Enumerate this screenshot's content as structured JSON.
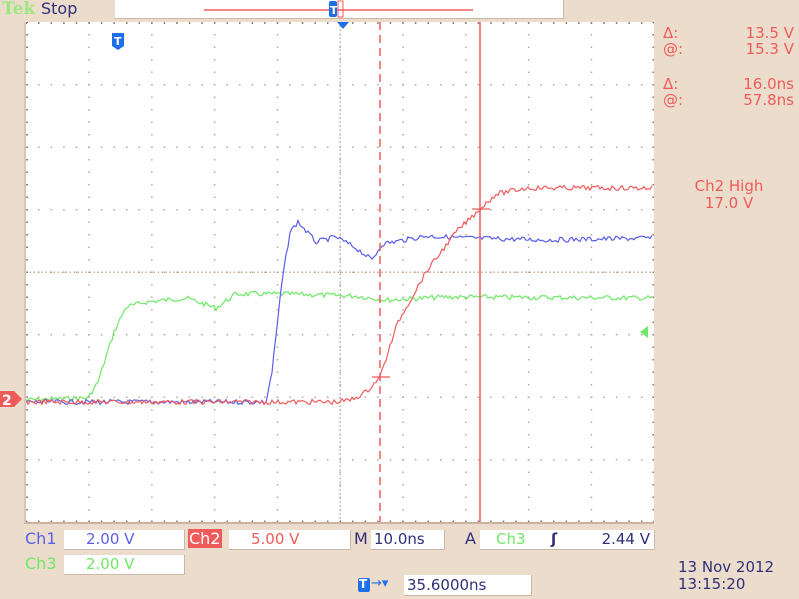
{
  "header": {
    "brand": "Tek",
    "acq_state": "Stop"
  },
  "colors": {
    "ch1": "#5a5ee8",
    "ch2": "#ef5b5b",
    "ch3": "#6ee865",
    "background": "#ecdccb",
    "trigger_marker": "#1f6fe8"
  },
  "measurements": {
    "volt_delta_symbol": "Δ:",
    "volt_delta_value": "13.5 V",
    "volt_at_symbol": "@:",
    "volt_at_value": "15.3 V",
    "time_delta_symbol": "Δ:",
    "time_delta_value": "16.0ns",
    "time_at_symbol": "@:",
    "time_at_value": "57.8ns",
    "trigger_level_label": "Ch2 High",
    "trigger_level_value": "17.0 V"
  },
  "channels": {
    "ch1": {
      "label": "Ch1",
      "scale": "2.00 V"
    },
    "ch2": {
      "label": "Ch2",
      "scale": "5.00 V",
      "marker": "2"
    },
    "ch3": {
      "label": "Ch3",
      "scale": "2.00 V"
    }
  },
  "timebase": {
    "prefix": "M",
    "scale": "10.0ns"
  },
  "trigger": {
    "mode": "A",
    "source": "Ch3",
    "slope_icon": "rising-edge",
    "slope_glyph": "ʃ",
    "level": "2.44 V",
    "marker_glyph": "T"
  },
  "horizontal_position": {
    "arrow": "→▾",
    "value": "35.6000ns"
  },
  "datetime": {
    "date": "13 Nov 2012",
    "time": "13:15:20"
  }
}
